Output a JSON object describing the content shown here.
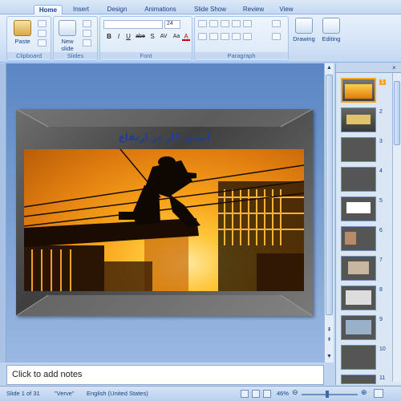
{
  "ribbon_tabs": [
    "Home",
    "Insert",
    "Design",
    "Animations",
    "Slide Show",
    "Review",
    "View"
  ],
  "clipboard": {
    "paste_label": "Paste",
    "group_label": "Clipboard"
  },
  "slides_group": {
    "new_slide_label": "New slide",
    "group_label": "Slides"
  },
  "font": {
    "size": "24",
    "group_label": "Font",
    "bold": "B",
    "italic": "I",
    "underline": "U",
    "strike": "abe",
    "shadow": "S",
    "spacing": "AV",
    "case": "Aa",
    "color": "A"
  },
  "paragraph": {
    "group_label": "Paragraph"
  },
  "drawing": {
    "label": "Drawing"
  },
  "editing": {
    "label": "Editing"
  },
  "slide": {
    "title": "ایمنی کار در ارتفاع"
  },
  "notes": {
    "placeholder": "Click to add notes"
  },
  "thumbnails": [
    "1",
    "2",
    "3",
    "4",
    "5",
    "6",
    "7",
    "8",
    "9",
    "10",
    "11"
  ],
  "status": {
    "slide_info": "Slide 1 of 31",
    "theme": "\"Verve\"",
    "language": "English (United States)",
    "zoom": "46%"
  },
  "colors": {
    "accent": "#f5a623",
    "ribbon": "#dbe8f7",
    "title": "#1f3d9a"
  }
}
